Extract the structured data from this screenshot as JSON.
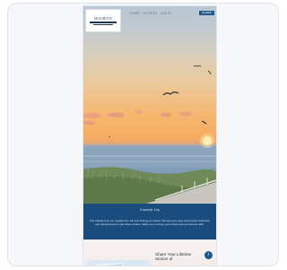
{
  "header": {
    "logo_name": "SEAGROVE",
    "nav_text": "HOME · STORIES · ABOUT",
    "cta_label": "SHARE"
  },
  "hero": {
    "band_title": "Coastal Joy",
    "band_text": "This website is for our coastal town. We love sharing our stories. We hope you enjoy these beach memories, and will add yours to help others explore. Share your morning, your sunset and your favorite walk."
  },
  "lower": {
    "headline": "Share Your Lifetime Stories of",
    "arrow": "›"
  },
  "colors": {
    "brand": "#1a4d7d",
    "button": "#1e5a8c"
  }
}
